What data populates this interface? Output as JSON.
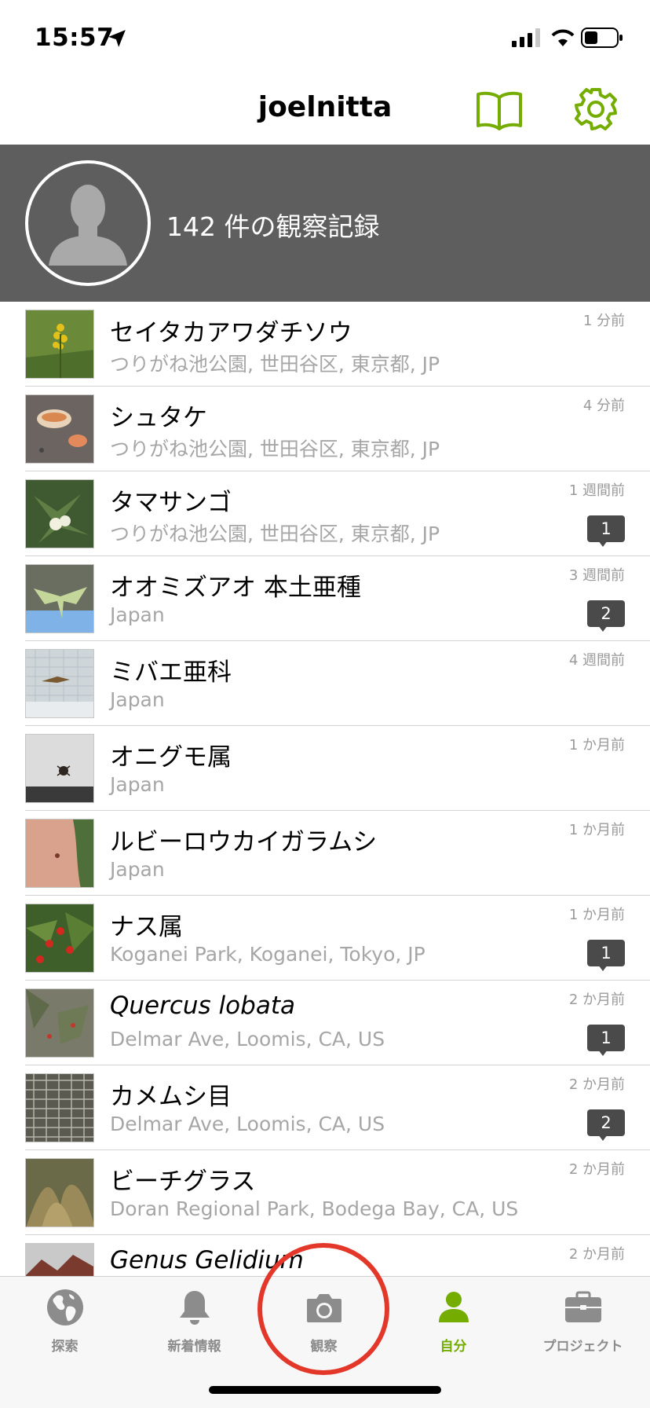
{
  "status_bar": {
    "time": "15:57"
  },
  "nav": {
    "title": "joelnitta"
  },
  "profile": {
    "observation_count_text": "142 件の観察記録"
  },
  "colors": {
    "accent": "#74ac00",
    "header_bg": "#5e5e5e",
    "annotation": "#e3372a"
  },
  "observations": [
    {
      "name": "セイタカアワダチソウ",
      "italic": false,
      "place": "つりがね池公園, 世田谷区, 東京都, JP",
      "time": "1 分前",
      "comments": null
    },
    {
      "name": "シュタケ",
      "italic": false,
      "place": "つりがね池公園, 世田谷区, 東京都, JP",
      "time": "4 分前",
      "comments": null
    },
    {
      "name": "タマサンゴ",
      "italic": false,
      "place": "つりがね池公園, 世田谷区, 東京都, JP",
      "time": "1 週間前",
      "comments": "1"
    },
    {
      "name": "オオミズアオ 本土亜種",
      "italic": false,
      "place": "Japan",
      "time": "3 週間前",
      "comments": "2"
    },
    {
      "name": "ミバエ亜科",
      "italic": false,
      "place": "Japan",
      "time": "4 週間前",
      "comments": null
    },
    {
      "name": "オニグモ属",
      "italic": false,
      "place": "Japan",
      "time": "1 か月前",
      "comments": null
    },
    {
      "name": "ルビーロウカイガラムシ",
      "italic": false,
      "place": "Japan",
      "time": "1 か月前",
      "comments": null
    },
    {
      "name": "ナス属",
      "italic": false,
      "place": "Koganei Park, Koganei, Tokyo, JP",
      "time": "1 か月前",
      "comments": "1"
    },
    {
      "name": "Quercus lobata",
      "italic": true,
      "place": "Delmar Ave, Loomis, CA, US",
      "time": "2 か月前",
      "comments": "1"
    },
    {
      "name": "カメムシ目",
      "italic": false,
      "place": "Delmar Ave, Loomis, CA, US",
      "time": "2 か月前",
      "comments": "2"
    },
    {
      "name": "ビーチグラス",
      "italic": false,
      "place": "Doran Regional Park, Bodega Bay, CA, US",
      "time": "2 か月前",
      "comments": null
    },
    {
      "name": "Genus Gelidium",
      "italic": true,
      "place": "",
      "time": "2 か月前",
      "comments": null
    }
  ],
  "tabs": [
    {
      "label": "探索",
      "icon": "globe-icon",
      "active": false
    },
    {
      "label": "新着情報",
      "icon": "bell-icon",
      "active": false
    },
    {
      "label": "観察",
      "icon": "camera-icon",
      "active": false
    },
    {
      "label": "自分",
      "icon": "person-icon",
      "active": true
    },
    {
      "label": "プロジェクト",
      "icon": "briefcase-icon",
      "active": false
    }
  ]
}
